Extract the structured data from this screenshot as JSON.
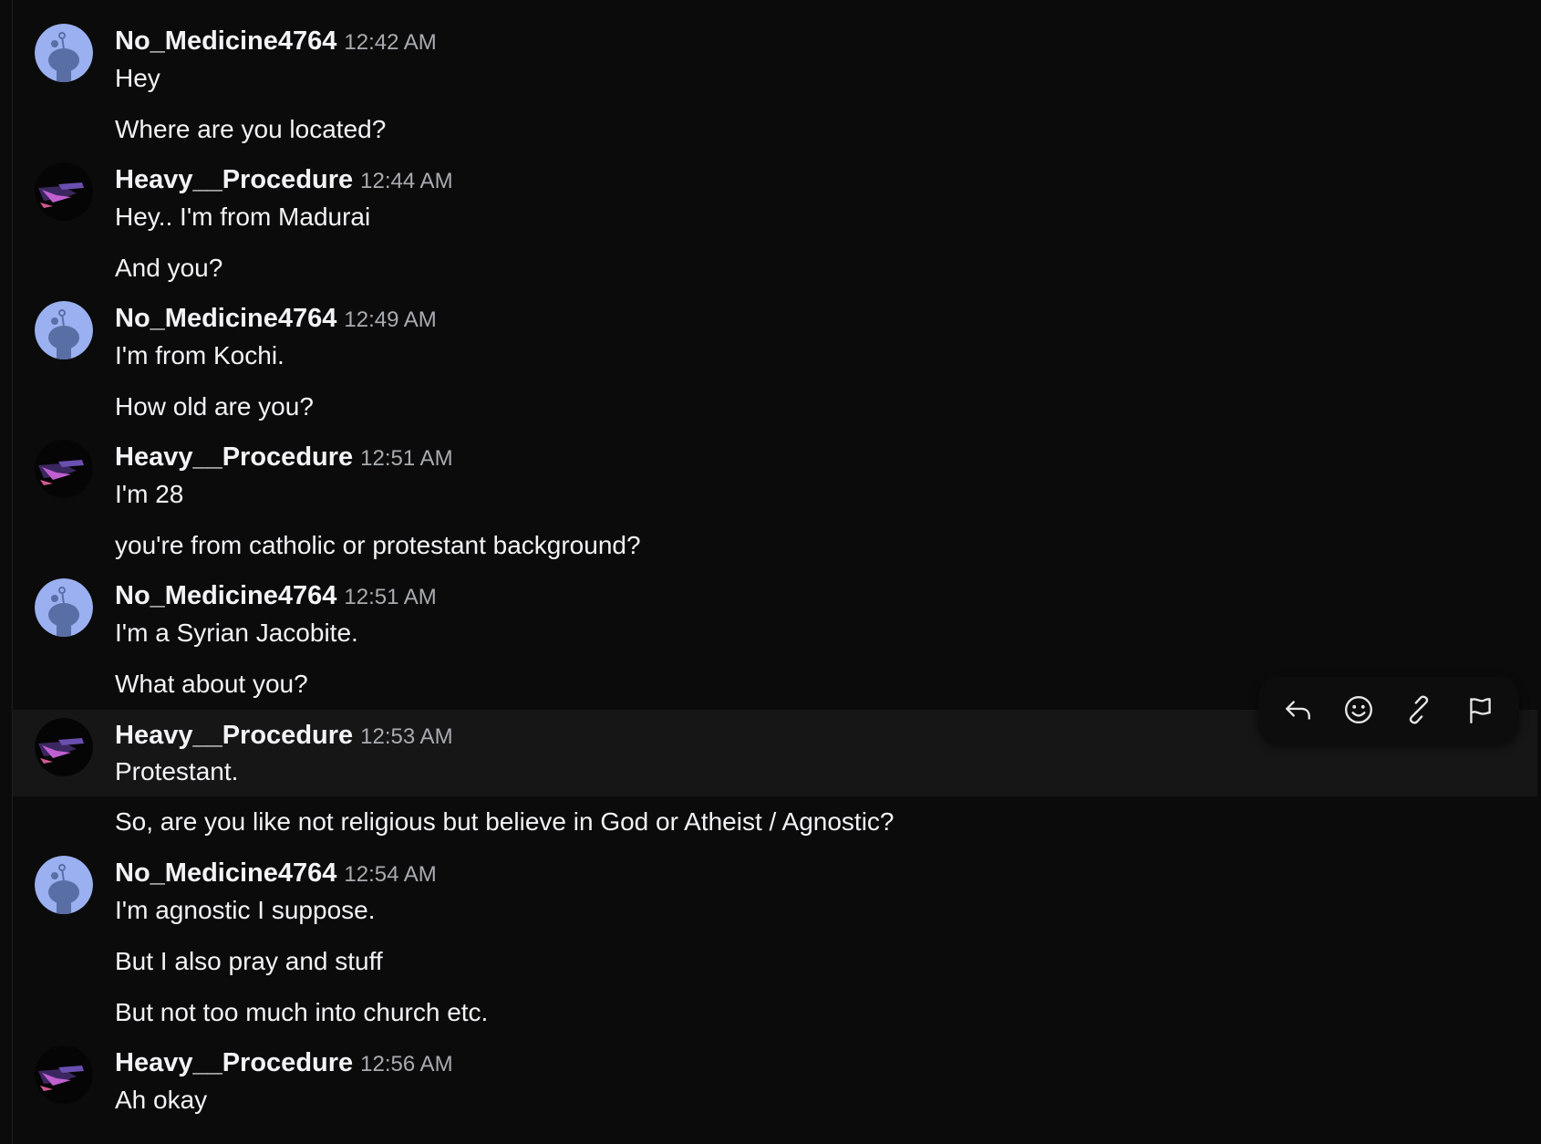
{
  "messages": [
    {
      "user": "No_Medicine4764",
      "avatar": "snoo-blue-avatar",
      "time": "12:42 AM",
      "lines": [
        "Hey",
        "Where are you located?"
      ]
    },
    {
      "user": "Heavy__Procedure",
      "avatar": "dark-purple-avatar",
      "time": "12:44 AM",
      "lines": [
        "Hey.. I'm from Madurai",
        "And you?"
      ]
    },
    {
      "user": "No_Medicine4764",
      "avatar": "snoo-blue-avatar",
      "time": "12:49 AM",
      "lines": [
        "I'm from Kochi.",
        "How old are you?"
      ]
    },
    {
      "user": "Heavy__Procedure",
      "avatar": "dark-purple-avatar",
      "time": "12:51 AM",
      "lines": [
        "I'm 28",
        "you're from catholic or protestant background?"
      ]
    },
    {
      "user": "No_Medicine4764",
      "avatar": "snoo-blue-avatar",
      "time": "12:51 AM",
      "lines": [
        "I'm a Syrian Jacobite.",
        "What about you?"
      ]
    },
    {
      "user": "Heavy__Procedure",
      "avatar": "dark-purple-avatar",
      "time": "12:53 AM",
      "lines": [
        "Protestant.",
        "So, are you like not religious but believe in God or Atheist / Agnostic?"
      ]
    },
    {
      "user": "No_Medicine4764",
      "avatar": "snoo-blue-avatar",
      "time": "12:54 AM",
      "lines": [
        "I'm agnostic I suppose.",
        "But I also pray and stuff",
        "But not too much into church etc."
      ]
    },
    {
      "user": "Heavy__Procedure",
      "avatar": "dark-purple-avatar",
      "time": "12:56 AM",
      "lines": [
        "Ah okay"
      ]
    }
  ],
  "hover_toolbar": {
    "icons": [
      "reply-icon",
      "emoji-icon",
      "link-icon",
      "flag-icon"
    ]
  },
  "colors": {
    "background": "#0b0b0b",
    "highlight_row": "#161616",
    "text": "#f2f3f5",
    "timestamp": "#a8abb0",
    "snoo_avatar_bg": "#9ab0f0"
  }
}
